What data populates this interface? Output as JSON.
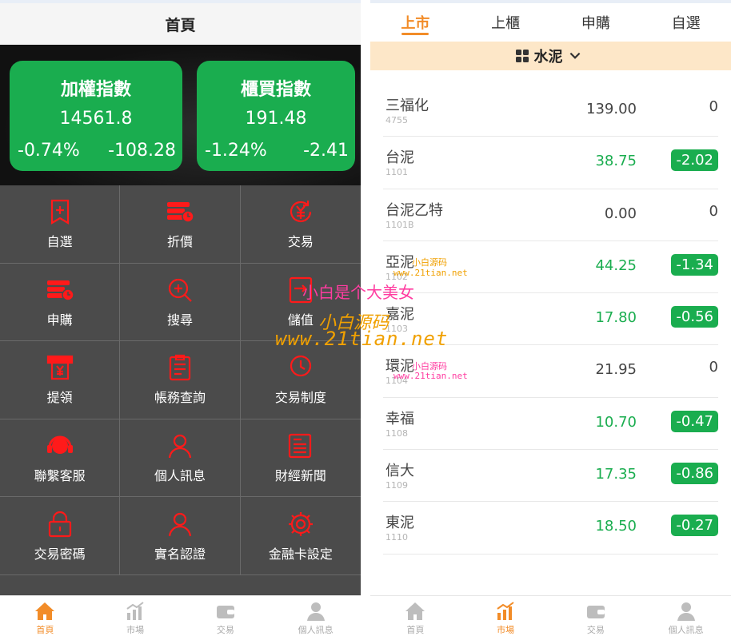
{
  "left": {
    "header_title": "首頁",
    "index_cards": [
      {
        "name": "加權指數",
        "value": "14561.8",
        "pct": "-0.74%",
        "change": "-108.28"
      },
      {
        "name": "櫃買指數",
        "value": "191.48",
        "pct": "-1.24%",
        "change": "-2.41"
      }
    ],
    "menu": [
      {
        "label": "自選",
        "icon": "bookmark-plus-icon"
      },
      {
        "label": "折價",
        "icon": "coins-clock-icon"
      },
      {
        "label": "交易",
        "icon": "yen-refresh-icon"
      },
      {
        "label": "申購",
        "icon": "coins-clock-icon"
      },
      {
        "label": "搜尋",
        "icon": "search-plus-icon"
      },
      {
        "label": "儲值",
        "icon": "deposit-icon"
      },
      {
        "label": "提領",
        "icon": "atm-yen-icon"
      },
      {
        "label": "帳務查詢",
        "icon": "clipboard-icon"
      },
      {
        "label": "交易制度",
        "icon": "rules-icon"
      },
      {
        "label": "聯繫客服",
        "icon": "headset-icon"
      },
      {
        "label": "個人訊息",
        "icon": "person-icon"
      },
      {
        "label": "財經新聞",
        "icon": "news-icon"
      },
      {
        "label": "交易密碼",
        "icon": "lock-icon"
      },
      {
        "label": "實名認證",
        "icon": "person-icon"
      },
      {
        "label": "金融卡設定",
        "icon": "gear-icon"
      }
    ],
    "tabbar": [
      {
        "label": "首頁",
        "icon": "home-icon",
        "active": true
      },
      {
        "label": "市場",
        "icon": "chart-icon",
        "active": false
      },
      {
        "label": "交易",
        "icon": "wallet-icon",
        "active": false
      },
      {
        "label": "個人訊息",
        "icon": "user-icon",
        "active": false
      }
    ]
  },
  "right": {
    "market_tabs": [
      "上市",
      "上櫃",
      "申購",
      "自選"
    ],
    "active_tab": "上市",
    "category": "水泥",
    "stocks": [
      {
        "name": "三福化",
        "code": "4755",
        "price": "139.00",
        "change": "0",
        "up": false
      },
      {
        "name": "台泥",
        "code": "1101",
        "price": "38.75",
        "change": "-2.02",
        "up": true
      },
      {
        "name": "台泥乙特",
        "code": "1101B",
        "price": "0.00",
        "change": "0",
        "up": false
      },
      {
        "name": "亞泥",
        "code": "1102",
        "price": "44.25",
        "change": "-1.34",
        "up": true
      },
      {
        "name": "嘉泥",
        "code": "1103",
        "price": "17.80",
        "change": "-0.56",
        "up": true
      },
      {
        "name": "環泥",
        "code": "1104",
        "price": "21.95",
        "change": "0",
        "up": false
      },
      {
        "name": "幸福",
        "code": "1108",
        "price": "10.70",
        "change": "-0.47",
        "up": true
      },
      {
        "name": "信大",
        "code": "1109",
        "price": "17.35",
        "change": "-0.86",
        "up": true
      },
      {
        "name": "東泥",
        "code": "1110",
        "price": "18.50",
        "change": "-0.27",
        "up": true
      }
    ],
    "tabbar": [
      {
        "label": "首頁",
        "icon": "home-icon",
        "active": false
      },
      {
        "label": "市場",
        "icon": "chart-icon",
        "active": true
      },
      {
        "label": "交易",
        "icon": "wallet-icon",
        "active": false
      },
      {
        "label": "個人訊息",
        "icon": "user-icon",
        "active": false
      }
    ]
  },
  "watermark": {
    "line1": "小白是个大美女",
    "line2": "小白源码",
    "line3": "www.21tian.net",
    "small_a": "小白源码",
    "small_b": "www.21tian.net",
    "color_main": "#f0a000",
    "color_pink": "#ff3ca0"
  },
  "colors": {
    "accent": "#f28c28",
    "green": "#1aad4f",
    "menu_red": "#ff1a1a",
    "grid_bg": "#4b4b4b"
  }
}
